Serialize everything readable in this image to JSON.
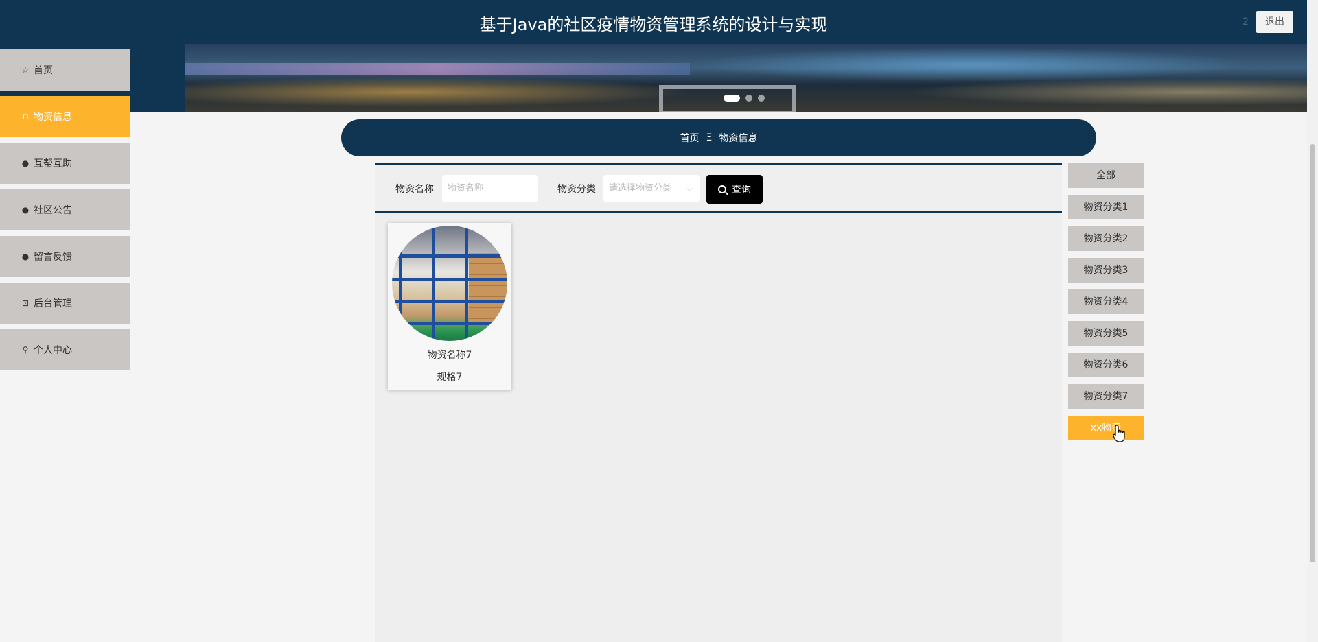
{
  "header": {
    "title": "基于Java的社区疫情物资管理系统的设计与实现",
    "user_number": "2",
    "logout_label": "退出"
  },
  "banner": {
    "slides_total": 3,
    "active_slide": 1
  },
  "sidebar": {
    "items": [
      {
        "label": "首页",
        "icon": "star-icon",
        "active": false
      },
      {
        "label": "物资信息",
        "icon": "bag-icon",
        "active": true
      },
      {
        "label": "互帮互助",
        "icon": "alert-icon",
        "active": false
      },
      {
        "label": "社区公告",
        "icon": "help-icon",
        "active": false
      },
      {
        "label": "留言反馈",
        "icon": "info-icon",
        "active": false
      },
      {
        "label": "后台管理",
        "icon": "toolbox-icon",
        "active": false
      },
      {
        "label": "个人中心",
        "icon": "user-icon",
        "active": false
      }
    ]
  },
  "breadcrumb": {
    "home": "首页",
    "separator": "Ξ",
    "current": "物资信息"
  },
  "search": {
    "name_label": "物资名称",
    "name_placeholder": "物资名称",
    "category_label": "物资分类",
    "category_placeholder": "请选择物资分类",
    "button_label": "查询"
  },
  "products": [
    {
      "name": "物资名称7",
      "spec": "规格7"
    }
  ],
  "categories": [
    {
      "label": "全部",
      "active": false
    },
    {
      "label": "物资分类1",
      "active": false
    },
    {
      "label": "物资分类2",
      "active": false
    },
    {
      "label": "物资分类3",
      "active": false
    },
    {
      "label": "物资分类4",
      "active": false
    },
    {
      "label": "物资分类5",
      "active": false
    },
    {
      "label": "物资分类6",
      "active": false
    },
    {
      "label": "物资分类7",
      "active": false
    },
    {
      "label": "xx物资",
      "active": true
    }
  ],
  "colors": {
    "header_bg": "#0f3552",
    "accent": "#fdb42c",
    "nav_bg": "#c9c6c4"
  }
}
